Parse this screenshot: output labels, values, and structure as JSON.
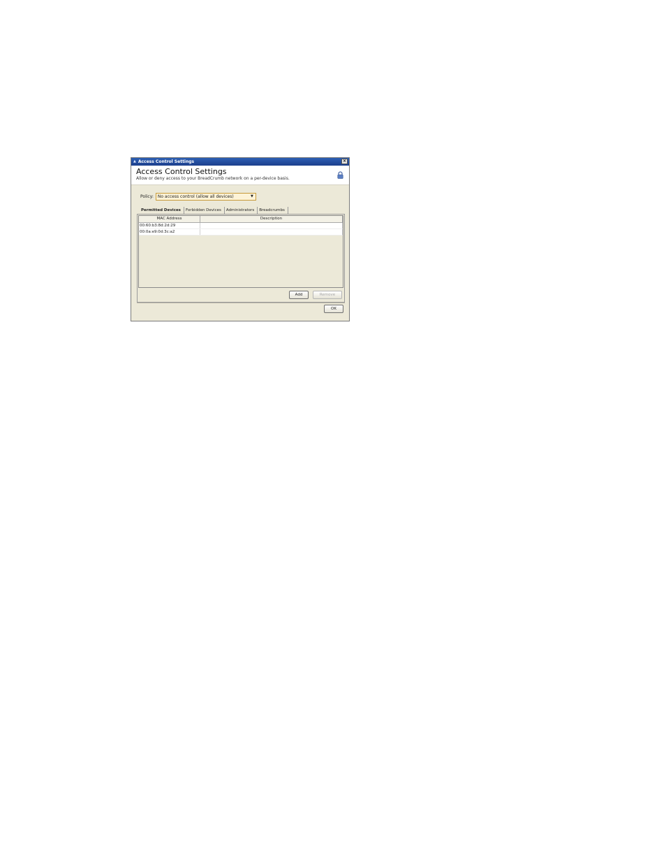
{
  "window": {
    "title": "Access Control Settings",
    "close_glyph": "×",
    "app_icon": "app-icon"
  },
  "banner": {
    "title": "Access Control Settings",
    "subtitle": "Allow or deny access to your BreadCrumb network on a per-device basis.",
    "icon": "lock-icon"
  },
  "policy": {
    "label": "Policy:",
    "selected": "No access control (allow all devices)"
  },
  "tabs": [
    {
      "label": "Permitted Devices",
      "active": true
    },
    {
      "label": "Forbidden Devices",
      "active": false
    },
    {
      "label": "Administrators",
      "active": false
    },
    {
      "label": "Breadcrumbs",
      "active": false
    }
  ],
  "table": {
    "columns": [
      "MAC Address",
      "Description"
    ],
    "rows": [
      {
        "mac": "00:60:b3:8d:2d:29",
        "description": ""
      },
      {
        "mac": "00:0a:e9:0d:3c:a2",
        "description": ""
      }
    ]
  },
  "buttons": {
    "add": "Add",
    "remove": "Remove",
    "ok": "OK"
  },
  "colors": {
    "titlebar": "#2d5fb4",
    "window_bg": "#ece9d8",
    "select_border": "#c79a3a"
  }
}
